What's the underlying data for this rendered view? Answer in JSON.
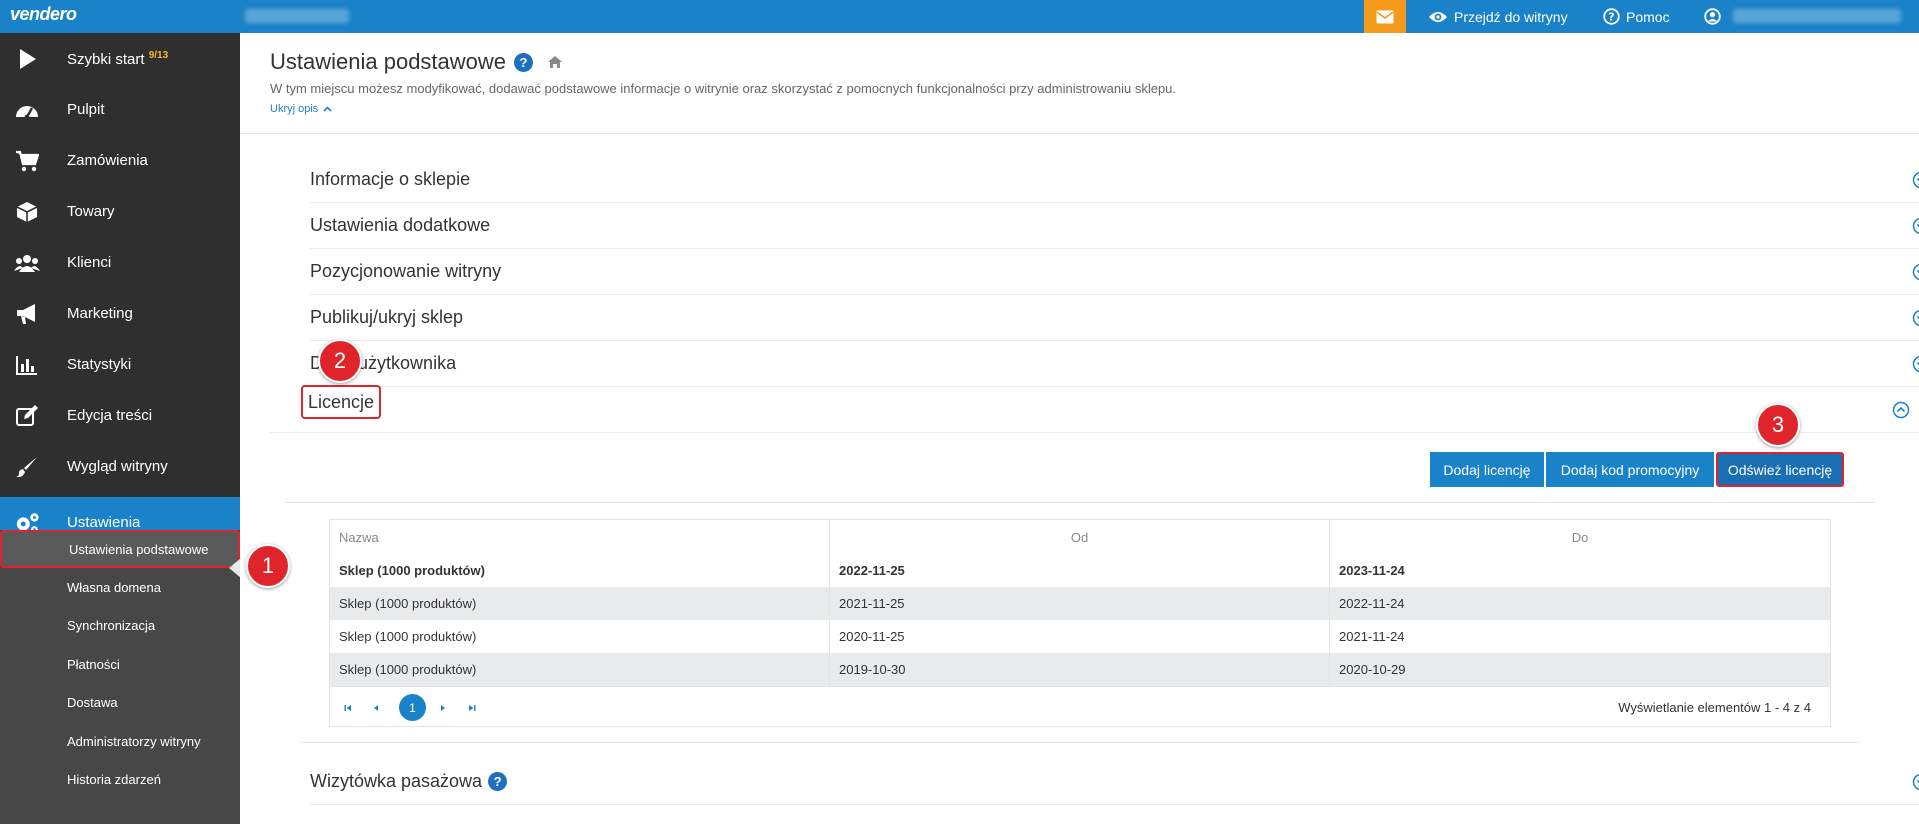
{
  "topbar": {
    "logo": "vendero",
    "mail_icon": "envelope-icon",
    "links": [
      {
        "label": "Przejdź do witryny",
        "icon": "eye-icon"
      },
      {
        "label": "Pomoc",
        "icon": "question-circle-icon"
      }
    ],
    "user_icon": "user-icon"
  },
  "sidebar": {
    "items": [
      {
        "label": "Szybki start",
        "badge": "9/13",
        "icon": "play-icon"
      },
      {
        "label": "Pulpit",
        "icon": "dashboard-icon"
      },
      {
        "label": "Zamówienia",
        "icon": "cart-icon"
      },
      {
        "label": "Towary",
        "icon": "box-icon"
      },
      {
        "label": "Klienci",
        "icon": "users-icon"
      },
      {
        "label": "Marketing",
        "icon": "megaphone-icon"
      },
      {
        "label": "Statystyki",
        "icon": "bar-chart-icon"
      },
      {
        "label": "Edycja treści",
        "icon": "edit-icon"
      },
      {
        "label": "Wygląd witryny",
        "icon": "brush-icon"
      },
      {
        "label": "Ustawienia",
        "icon": "cogs-icon"
      }
    ],
    "submenu": [
      "Ustawienia podstawowe",
      "Własna domena",
      "Synchronizacja",
      "Płatności",
      "Dostawa",
      "Administratorzy witryny",
      "Historia zdarzeń"
    ]
  },
  "header": {
    "title": "Ustawienia podstawowe",
    "description": "W tym miejscu możesz modyfikować, dodawać podstawowe informacje o witrynie oraz skorzystać z pomocnych funkcjonalności przy administrowaniu sklepu.",
    "hide_desc": "Ukryj opis"
  },
  "sections": [
    "Informacje o sklepie",
    "Ustawienia dodatkowe",
    "Pozycjonowanie witryny",
    "Publikuj/ukryj sklep",
    "Dane użytkownika",
    "Licencje",
    "Wizytówka pasażowa"
  ],
  "licencje": {
    "buttons": [
      "Dodaj licencję",
      "Dodaj kod promocyjny",
      "Odśwież licencję"
    ],
    "columns": [
      "Nazwa",
      "Od",
      "Do"
    ],
    "rows": [
      [
        "Sklep (1000 produktów)",
        "2022-11-25",
        "2023-11-24"
      ],
      [
        "Sklep (1000 produktów)",
        "2021-11-25",
        "2022-11-24"
      ],
      [
        "Sklep (1000 produktów)",
        "2020-11-25",
        "2021-11-24"
      ],
      [
        "Sklep (1000 produktów)",
        "2019-10-30",
        "2020-10-29"
      ]
    ],
    "pager": {
      "current_page": "1",
      "info": "Wyświetlanie elementów 1 - 4 z 4"
    }
  },
  "annotations": [
    "1",
    "2",
    "3"
  ],
  "colors": {
    "topbar": "#1a82c8",
    "sidebar": "#2f2f2f",
    "submenu": "#474747",
    "accent_orange": "#f59a1b",
    "highlight_red": "#e0242b"
  }
}
